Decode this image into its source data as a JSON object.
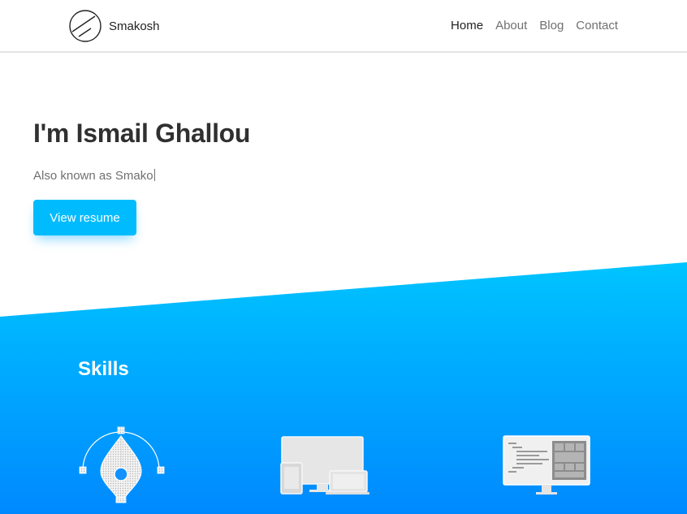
{
  "header": {
    "brand": "Smakosh",
    "nav": [
      {
        "label": "Home",
        "active": true
      },
      {
        "label": "About",
        "active": false
      },
      {
        "label": "Blog",
        "active": false
      },
      {
        "label": "Contact",
        "active": false
      }
    ]
  },
  "hero": {
    "title": "I'm Ismail Ghallou",
    "subtitle": "Also known as Smako",
    "button": "View resume"
  },
  "skills": {
    "title": "Skills",
    "icons": [
      "pen-tool-icon",
      "responsive-devices-icon",
      "code-editor-icon"
    ]
  },
  "colors": {
    "accent": "#00bcff",
    "gradient_top": "#00c4ff",
    "gradient_bottom": "#0089ff",
    "heading": "#303030",
    "muted": "#707070"
  }
}
